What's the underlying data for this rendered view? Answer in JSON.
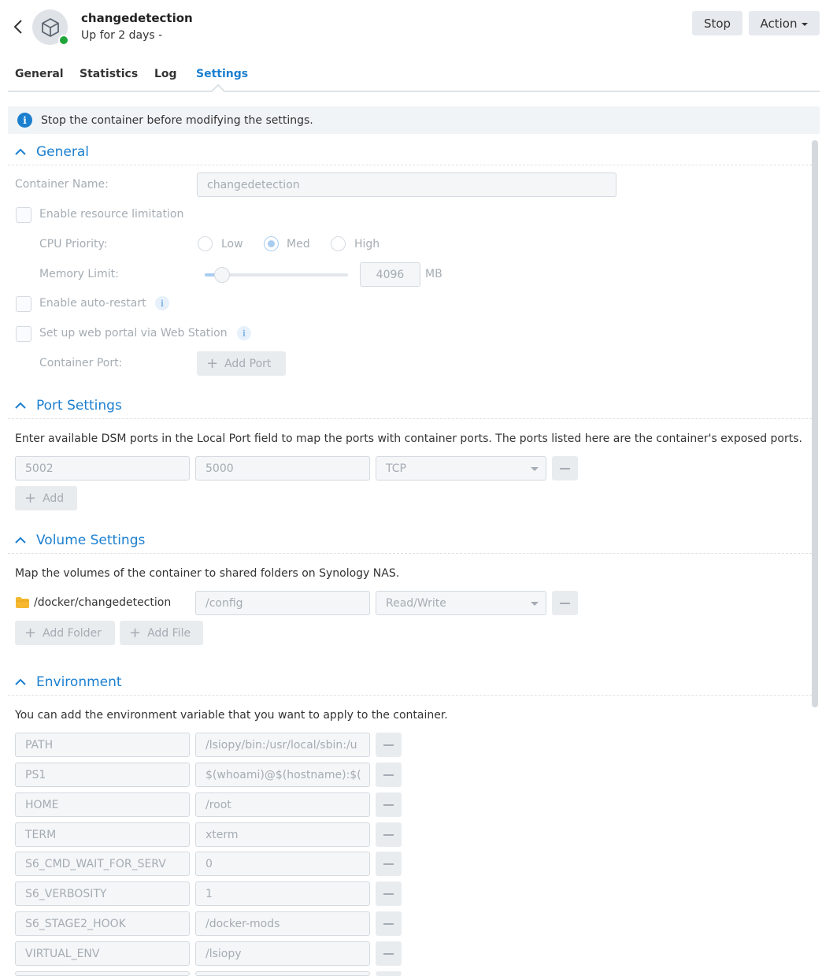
{
  "header": {
    "title": "changedetection",
    "subtitle": "Up for 2 days -",
    "stop_label": "Stop",
    "action_label": "Action",
    "status_color": "#1fa53a"
  },
  "tabs": [
    {
      "label": "General"
    },
    {
      "label": "Statistics"
    },
    {
      "label": "Log"
    },
    {
      "label": "Settings",
      "active": true
    }
  ],
  "notice": "Stop the container before modifying the settings.",
  "general": {
    "title": "General",
    "container_name_label": "Container Name:",
    "container_name_value": "changedetection",
    "resource_limit_label": "Enable resource limitation",
    "cpu_priority_label": "CPU Priority:",
    "cpu_options": [
      "Low",
      "Med",
      "High"
    ],
    "cpu_selected": "Med",
    "memory_label": "Memory Limit:",
    "memory_value": "4096",
    "memory_unit": "MB",
    "memory_slider_fraction": 0.12,
    "auto_restart_label": "Enable auto-restart",
    "web_portal_label": "Set up web portal via Web Station",
    "container_port_label": "Container Port:",
    "add_port_label": "Add Port"
  },
  "ports": {
    "title": "Port Settings",
    "description": "Enter available DSM ports in the Local Port field to map the ports with container ports. The ports listed here are the container's exposed ports.",
    "rows": [
      {
        "local": "5002",
        "container": "5000",
        "protocol": "TCP"
      }
    ],
    "add_label": "Add"
  },
  "volumes": {
    "title": "Volume Settings",
    "description": "Map the volumes of the container to shared folders on Synology NAS.",
    "rows": [
      {
        "folder": "/docker/changedetection",
        "mount": "/config",
        "mode": "Read/Write"
      }
    ],
    "add_folder_label": "Add Folder",
    "add_file_label": "Add File"
  },
  "environment": {
    "title": "Environment",
    "description": "You can add the environment variable that you want to apply to the container.",
    "rows": [
      {
        "key": "PATH",
        "value": "/lsiopy/bin:/usr/local/sbin:/u"
      },
      {
        "key": "PS1",
        "value": "$(whoami)@$(hostname):$("
      },
      {
        "key": "HOME",
        "value": "/root"
      },
      {
        "key": "TERM",
        "value": "xterm"
      },
      {
        "key": "S6_CMD_WAIT_FOR_SERV",
        "value": "0"
      },
      {
        "key": "S6_VERBOSITY",
        "value": "1"
      },
      {
        "key": "S6_STAGE2_HOOK",
        "value": "/docker-mods"
      },
      {
        "key": "VIRTUAL_ENV",
        "value": "/lsiopy"
      }
    ]
  },
  "colors": {
    "accent": "#1b7fd0",
    "status_running": "#1fa53a",
    "folder": "#f5b82e"
  }
}
